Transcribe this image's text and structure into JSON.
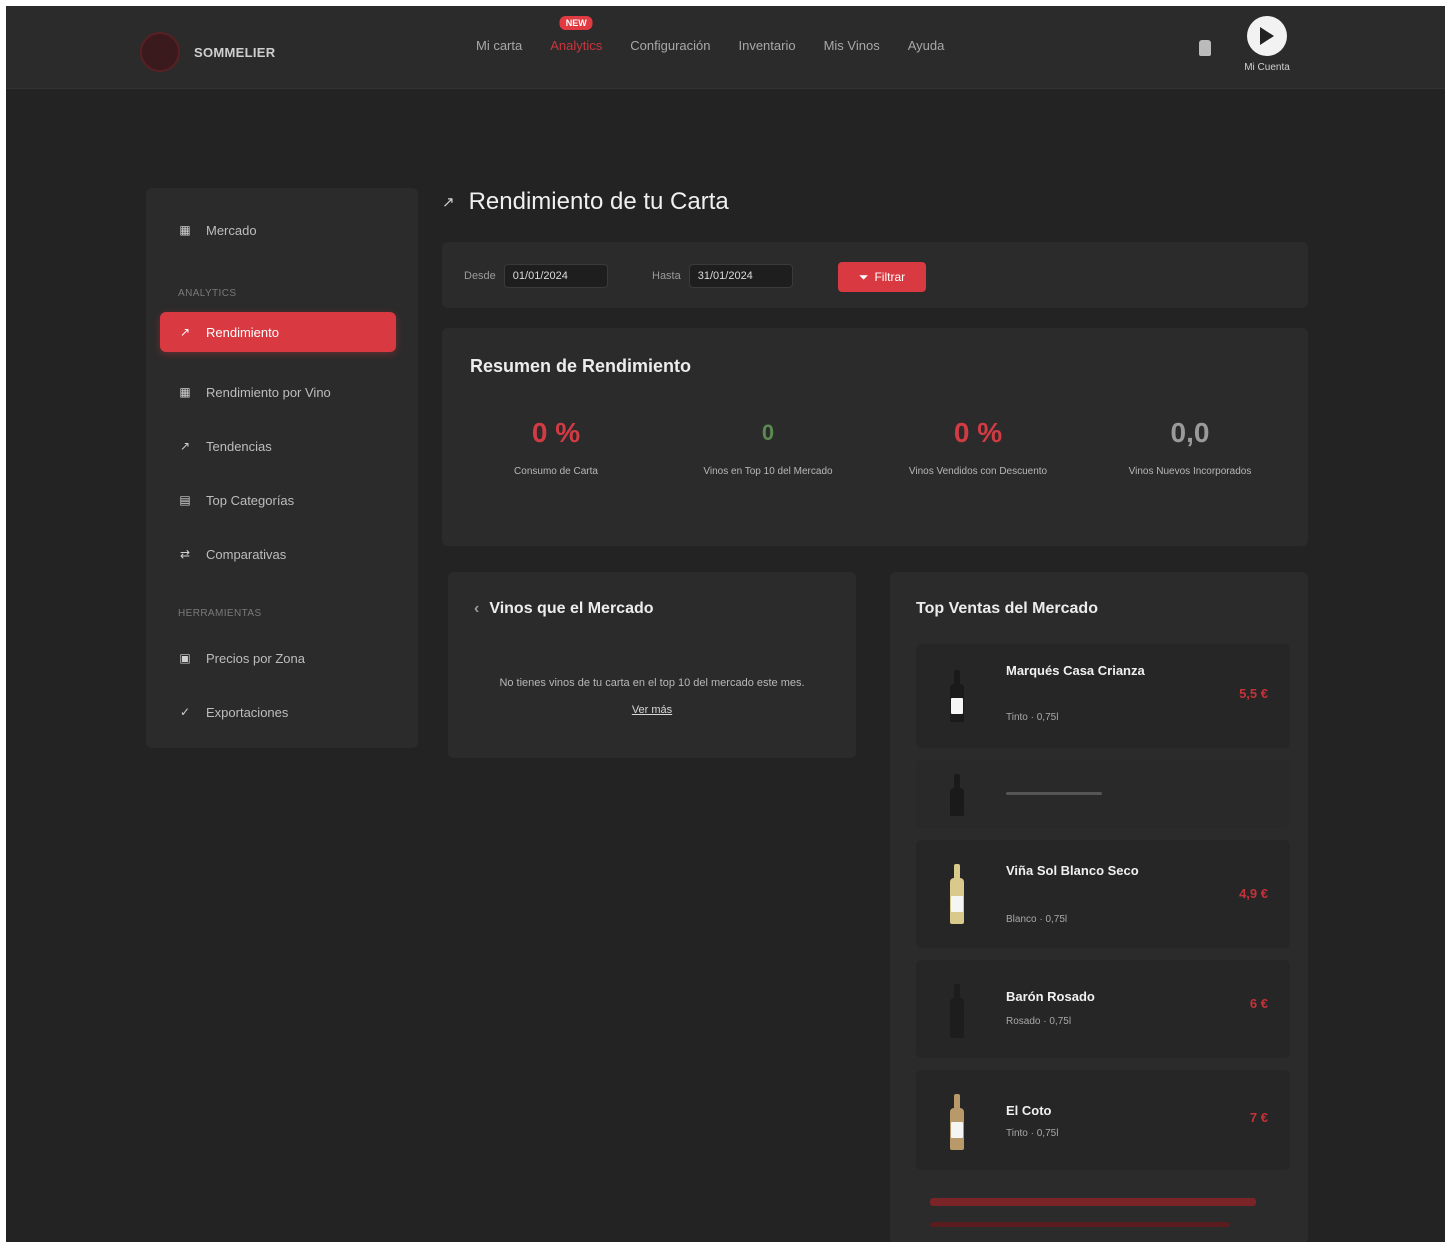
{
  "app": {
    "name": "SOMMELIER"
  },
  "nav": {
    "items": [
      "Mi carta",
      "Analytics",
      "Configuración",
      "Inventario",
      "Mis Vinos",
      "Ayuda"
    ],
    "badge": "NEW",
    "active": "Analytics"
  },
  "user": {
    "name": "Mi Cuenta"
  },
  "sidebar": {
    "top_item": {
      "label": "Mercado",
      "icon": "store-icon"
    },
    "section1": "ANALYTICS",
    "items": [
      {
        "label": "Rendimiento",
        "icon": "chart-icon",
        "active": true
      },
      {
        "label": "Rendimiento por Vino",
        "icon": "grid-icon"
      },
      {
        "label": "Tendencias",
        "icon": "trend-icon"
      },
      {
        "label": "Top Categorías",
        "icon": "category-icon"
      },
      {
        "label": "Comparativas",
        "icon": "compare-icon"
      }
    ],
    "section2": "HERRAMIENTAS",
    "tools": [
      {
        "label": "Precios por Zona",
        "icon": "tag-icon"
      },
      {
        "label": "Exportaciones",
        "icon": "export-icon"
      }
    ]
  },
  "main": {
    "title": "Rendimiento de tu Carta",
    "filters": {
      "from_label": "Desde",
      "from_value": "01/01/2024",
      "to_label": "Hasta",
      "to_value": "31/01/2024",
      "button": "Filtrar"
    },
    "summary": {
      "title": "Resumen de Rendimiento",
      "metrics": [
        {
          "value": "0 %",
          "label": "Consumo de Carta",
          "color": "#d23b43"
        },
        {
          "value": "0",
          "label": "Vinos en Top 10 del Mercado",
          "color": "#5a8a50"
        },
        {
          "value": "0 %",
          "label": "Vinos Vendidos con Descuento",
          "color": "#d23b43"
        },
        {
          "value": "0,0",
          "label": "Vinos Nuevos Incorporados",
          "color": "#9a9a9a"
        }
      ]
    },
    "market_card": {
      "title": "Vinos que el Mercado",
      "empty_message": "No tienes vinos de tu carta en el top 10 del mercado este mes.",
      "link": "Ver más"
    },
    "top_card": {
      "title": "Top Ventas del Mercado",
      "wines": [
        {
          "name": "Marqués Casa Crianza",
          "sub": "Tinto · 0,75l",
          "price": "5,5 €"
        },
        {
          "name": "",
          "sub": "",
          "price": ""
        },
        {
          "name": "Viña Sol Blanco Seco",
          "sub": "Blanco · 0,75l",
          "price": "4,9 €"
        },
        {
          "name": "Barón Rosado",
          "sub": "Rosado · 0,75l",
          "price": "6 €"
        },
        {
          "name": "El Coto",
          "sub": "Tinto · 0,75l",
          "price": "7 €"
        }
      ]
    }
  },
  "colors": {
    "accent": "#d93a41",
    "background": "#232323",
    "card": "#2b2b2b"
  }
}
